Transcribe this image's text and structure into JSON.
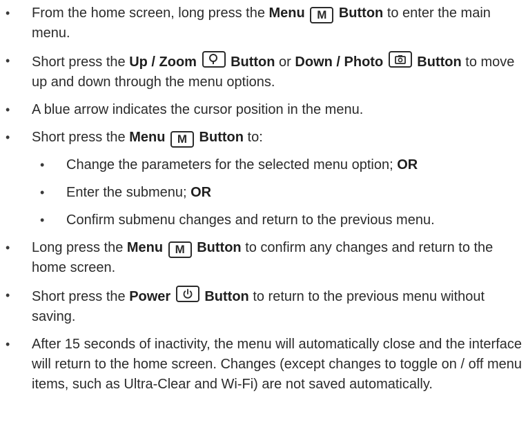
{
  "bullet": "•",
  "keys": {
    "menu": "M"
  },
  "items": [
    {
      "a": "From the home screen, long press the ",
      "b1": "Menu",
      "b2": "Button",
      "c": " to enter the main menu."
    },
    {
      "a": "Short press the ",
      "b1": "Up / Zoom",
      "b2": "Button",
      "mid": " or ",
      "b3": "Down / Photo",
      "b4": "Button",
      "c": " to move up and down through the menu options."
    },
    {
      "a": "A blue arrow indicates the cursor position in the menu."
    },
    {
      "a": "Short press the ",
      "b1": "Menu",
      "b2": "Button",
      "c": " to:",
      "sub": [
        {
          "a": "Change the parameters for the selected menu option; ",
          "b": "OR"
        },
        {
          "a": "Enter the submenu; ",
          "b": "OR"
        },
        {
          "a": "Confirm submenu changes and return to the previous menu."
        }
      ]
    },
    {
      "a": "Long press the ",
      "b1": "Menu",
      "b2": "Button",
      "c": " to confirm any changes and return to the home screen."
    },
    {
      "a": "Short press the ",
      "b1": "Power",
      "b2": "Button",
      "c": " to return to the previous menu without saving."
    },
    {
      "a": "After 15 seconds of inactivity, the menu will automatically close and the interface will return to the home screen. Changes (except changes to toggle on / off menu items, such as Ultra-Clear and Wi-Fi) are not saved automatically."
    }
  ]
}
